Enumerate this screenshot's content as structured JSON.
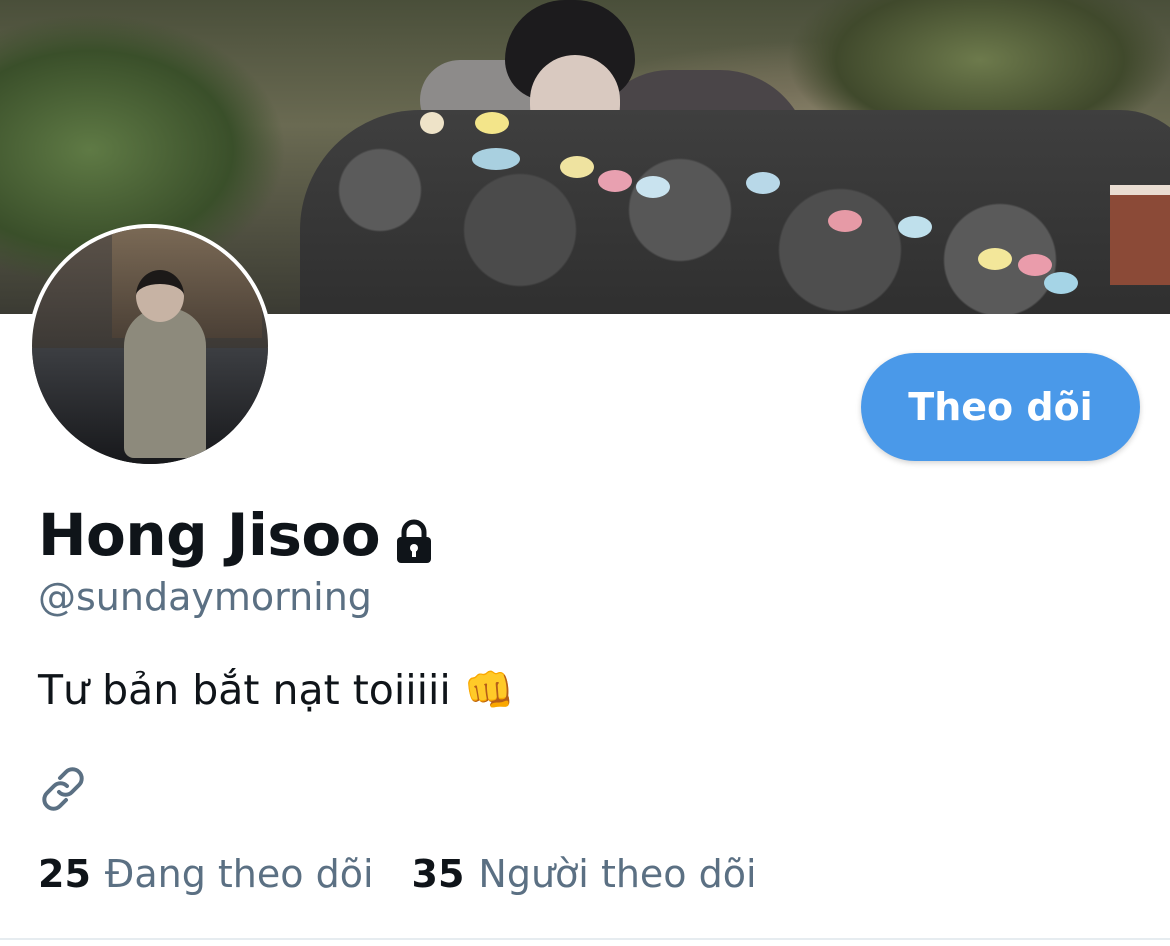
{
  "profile": {
    "display_name": "Hong Jisoo",
    "handle": "@sundaymorning",
    "bio": "Tư bản bắt nạt toiiiii 👊",
    "protected_icon": "lock-icon",
    "link_icon": "link-icon"
  },
  "actions": {
    "follow_label": "Theo dõi"
  },
  "stats": {
    "following_count": "25",
    "following_label": "Đang theo dõi",
    "followers_count": "35",
    "followers_label": "Người theo dõi"
  },
  "colors": {
    "accent": "#4a99e9",
    "text_primary": "#0f1419",
    "text_secondary": "#5b7083"
  }
}
